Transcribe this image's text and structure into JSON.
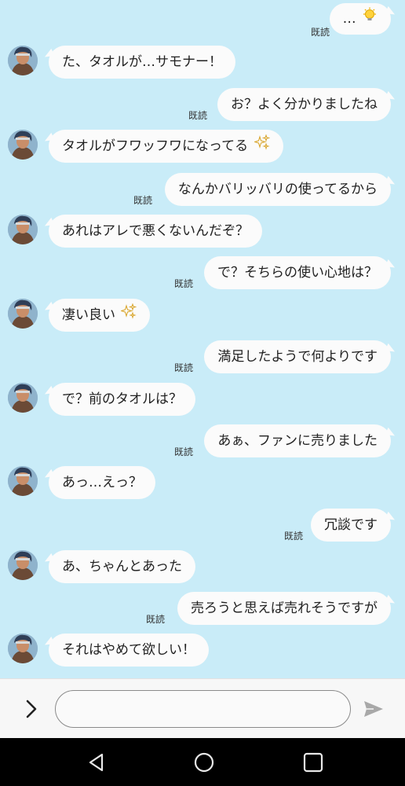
{
  "read_label": "既読",
  "messages": [
    {
      "side": "out",
      "text": "…",
      "icon": "lightbulb"
    },
    {
      "side": "in",
      "text": "た、タオルが…サモナー！"
    },
    {
      "side": "out",
      "text": "お？よく分かりましたね"
    },
    {
      "side": "in",
      "text": "タオルがフワッフワになってる",
      "icon": "sparkles"
    },
    {
      "side": "out",
      "text": "なんかバリッバリの使ってるから"
    },
    {
      "side": "in",
      "text": "あれはアレで悪くないんだぞ？"
    },
    {
      "side": "out",
      "text": "で？そちらの使い心地は？"
    },
    {
      "side": "in",
      "text": "凄い良い",
      "icon": "sparkles"
    },
    {
      "side": "out",
      "text": "満足したようで何よりです"
    },
    {
      "side": "in",
      "text": "で？前のタオルは？"
    },
    {
      "side": "out",
      "text": "あぁ、ファンに売りました"
    },
    {
      "side": "in",
      "text": "あっ…えっ？"
    },
    {
      "side": "out",
      "text": "冗談です"
    },
    {
      "side": "in",
      "text": "あ、ちゃんとあった"
    },
    {
      "side": "out",
      "text": "売ろうと思えば売れそうですが"
    },
    {
      "side": "in",
      "text": "それはやめて欲しい！"
    }
  ],
  "input": {
    "value": "",
    "placeholder": ""
  },
  "icons": {
    "expand": "chevron-right-icon",
    "send": "send-icon",
    "nav_back": "back-triangle-icon",
    "nav_home": "home-circle-icon",
    "nav_recents": "recents-square-icon"
  },
  "colors": {
    "background": "#c9ecf8",
    "bubble": "#fbfbfb",
    "navbar": "#000000"
  }
}
